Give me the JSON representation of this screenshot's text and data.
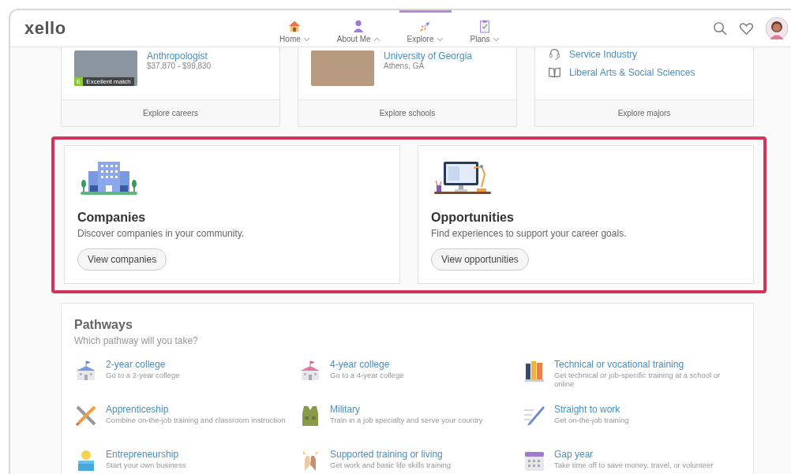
{
  "logo": "xello",
  "nav": [
    {
      "label": "Home",
      "selected": false,
      "expanded": false
    },
    {
      "label": "About Me",
      "selected": false,
      "expanded": true
    },
    {
      "label": "Explore",
      "selected": true,
      "expanded": false
    },
    {
      "label": "Plans",
      "selected": false,
      "expanded": false
    }
  ],
  "career_card": {
    "title": "Anthropologist",
    "salary": "$37,870 - $99,830",
    "badge_letter": "E",
    "badge_label": "Excellent match",
    "footer": "Explore careers"
  },
  "school_card": {
    "title": "University of Georgia",
    "location": "Athens, GA",
    "footer": "Explore schools"
  },
  "majors_card": {
    "items": [
      "Service Industry",
      "Liberal Arts & Social Sciences"
    ],
    "footer": "Explore majors"
  },
  "features": [
    {
      "title": "Companies",
      "description": "Discover companies in your community.",
      "button": "View companies"
    },
    {
      "title": "Opportunities",
      "description": "Find experiences to support your career goals.",
      "button": "View opportunities"
    }
  ],
  "pathways": {
    "title": "Pathways",
    "subtitle": "Which pathway will you take?",
    "items": [
      {
        "title": "2-year college",
        "description": "Go to a 2-year college"
      },
      {
        "title": "4-year college",
        "description": "Go to a 4-year college"
      },
      {
        "title": "Technical or vocational training",
        "description": "Get technical or job-specific training at a school or online"
      },
      {
        "title": "Apprenticeship",
        "description": "Combine on-the-job training and classroom instruction"
      },
      {
        "title": "Military",
        "description": "Train in a job specialty and serve your country"
      },
      {
        "title": "Straight to work",
        "description": "Get on-the-job training"
      },
      {
        "title": "Entrepreneurship",
        "description": "Start your own business"
      },
      {
        "title": "Supported training or living",
        "description": "Get work and basic life skills training"
      },
      {
        "title": "Gap year",
        "description": "Take time off to save money, travel, or volunteer"
      }
    ]
  }
}
